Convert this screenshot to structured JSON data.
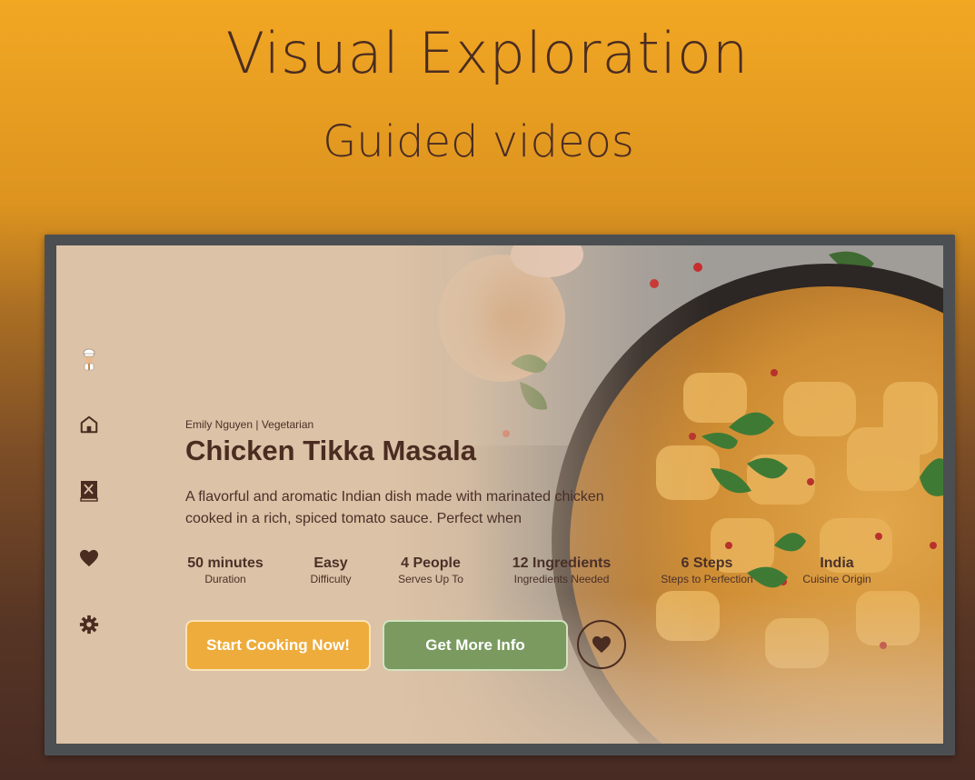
{
  "hero": {
    "title": "Visual Exploration",
    "subtitle": "Guided videos"
  },
  "sidebar": {
    "items": [
      {
        "icon": "chef-logo-icon"
      },
      {
        "icon": "home-icon"
      },
      {
        "icon": "recipe-book-icon"
      },
      {
        "icon": "heart-icon"
      },
      {
        "icon": "gear-icon"
      }
    ]
  },
  "recipe": {
    "byline": "Emily Nguyen | Vegetarian",
    "title": "Chicken Tikka Masala",
    "description": "A flavorful and aromatic Indian dish made with marinated chicken cooked in a rich, spiced tomato sauce. Perfect when",
    "stats": [
      {
        "value": "50 minutes",
        "label": "Duration"
      },
      {
        "value": "Easy",
        "label": "Difficulty"
      },
      {
        "value": "4 People",
        "label": "Serves Up To"
      },
      {
        "value": "12 Ingredients",
        "label": "Ingredients Needed"
      },
      {
        "value": "6 Steps",
        "label": "Steps to Perfection"
      },
      {
        "value": "India",
        "label": "Cuisine Origin"
      }
    ]
  },
  "actions": {
    "start_label": "Start Cooking Now!",
    "info_label": "Get More Info",
    "favorite_icon": "heart-icon"
  },
  "colors": {
    "background_top": "#f2a723",
    "background_bottom": "#482b23",
    "text_dark": "#4a2c21",
    "screen_cream": "#dcc2a6",
    "start_button": "#eeac3c",
    "info_button": "#7a9a60"
  }
}
